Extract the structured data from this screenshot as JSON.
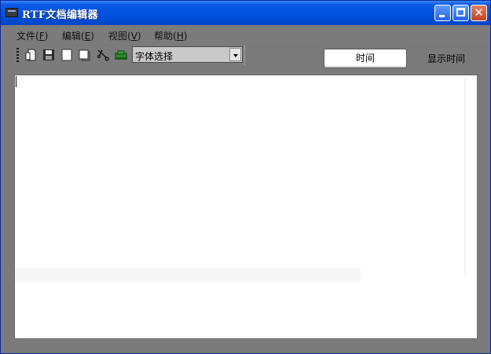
{
  "window": {
    "title": "RTF文档编辑器"
  },
  "menu": {
    "items": [
      {
        "label": "文件(",
        "key": "F",
        "close": ")"
      },
      {
        "label": "编辑(",
        "key": "E",
        "close": ")"
      },
      {
        "label": "视图(",
        "key": "V",
        "close": ")"
      },
      {
        "label": "帮助(",
        "key": "H",
        "close": ")"
      }
    ]
  },
  "toolbar": {
    "icons": [
      "new-document-icon",
      "open-folder-icon",
      "save-icon",
      "blank-page-icon",
      "copy-icon",
      "cut-icon",
      "paste-icon"
    ],
    "font_select": "字体选择"
  },
  "time_button": {
    "label": "时间"
  },
  "time_display": {
    "label": "显示时间"
  },
  "editor": {
    "content": ""
  },
  "colors": {
    "titlebar": "#0051de",
    "frame": "#7b7b7b",
    "editor_bg": "#ffffff"
  }
}
